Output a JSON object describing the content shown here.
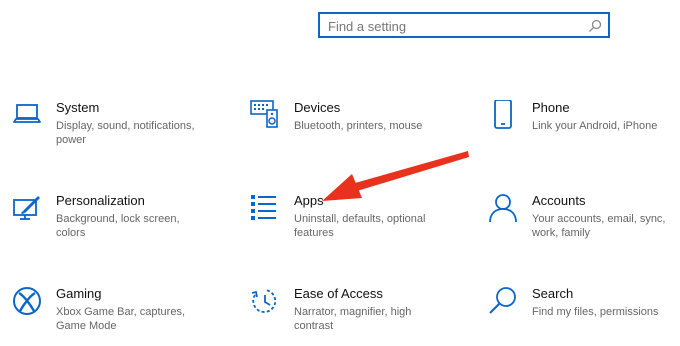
{
  "search": {
    "placeholder": "Find a setting"
  },
  "tiles": [
    {
      "title": "System",
      "desc": "Display, sound, notifications, power"
    },
    {
      "title": "Devices",
      "desc": "Bluetooth, printers, mouse"
    },
    {
      "title": "Phone",
      "desc": "Link your Android, iPhone"
    },
    {
      "title": "Personalization",
      "desc": "Background, lock screen, colors"
    },
    {
      "title": "Apps",
      "desc": "Uninstall, defaults, optional features"
    },
    {
      "title": "Accounts",
      "desc": "Your accounts, email, sync, work, family"
    },
    {
      "title": "Gaming",
      "desc": "Xbox Game Bar, captures, Game Mode"
    },
    {
      "title": "Ease of Access",
      "desc": "Narrator, magnifier, high contrast"
    },
    {
      "title": "Search",
      "desc": "Find my files, permissions"
    }
  ],
  "colors": {
    "accent": "#0a66c8",
    "annotation_arrow": "#e8321e"
  },
  "icons": [
    "laptop-icon",
    "keyboard-speaker-icon",
    "phone-icon",
    "personalization-icon",
    "apps-list-icon",
    "person-icon",
    "xbox-icon",
    "ease-of-access-icon",
    "search-icon"
  ]
}
